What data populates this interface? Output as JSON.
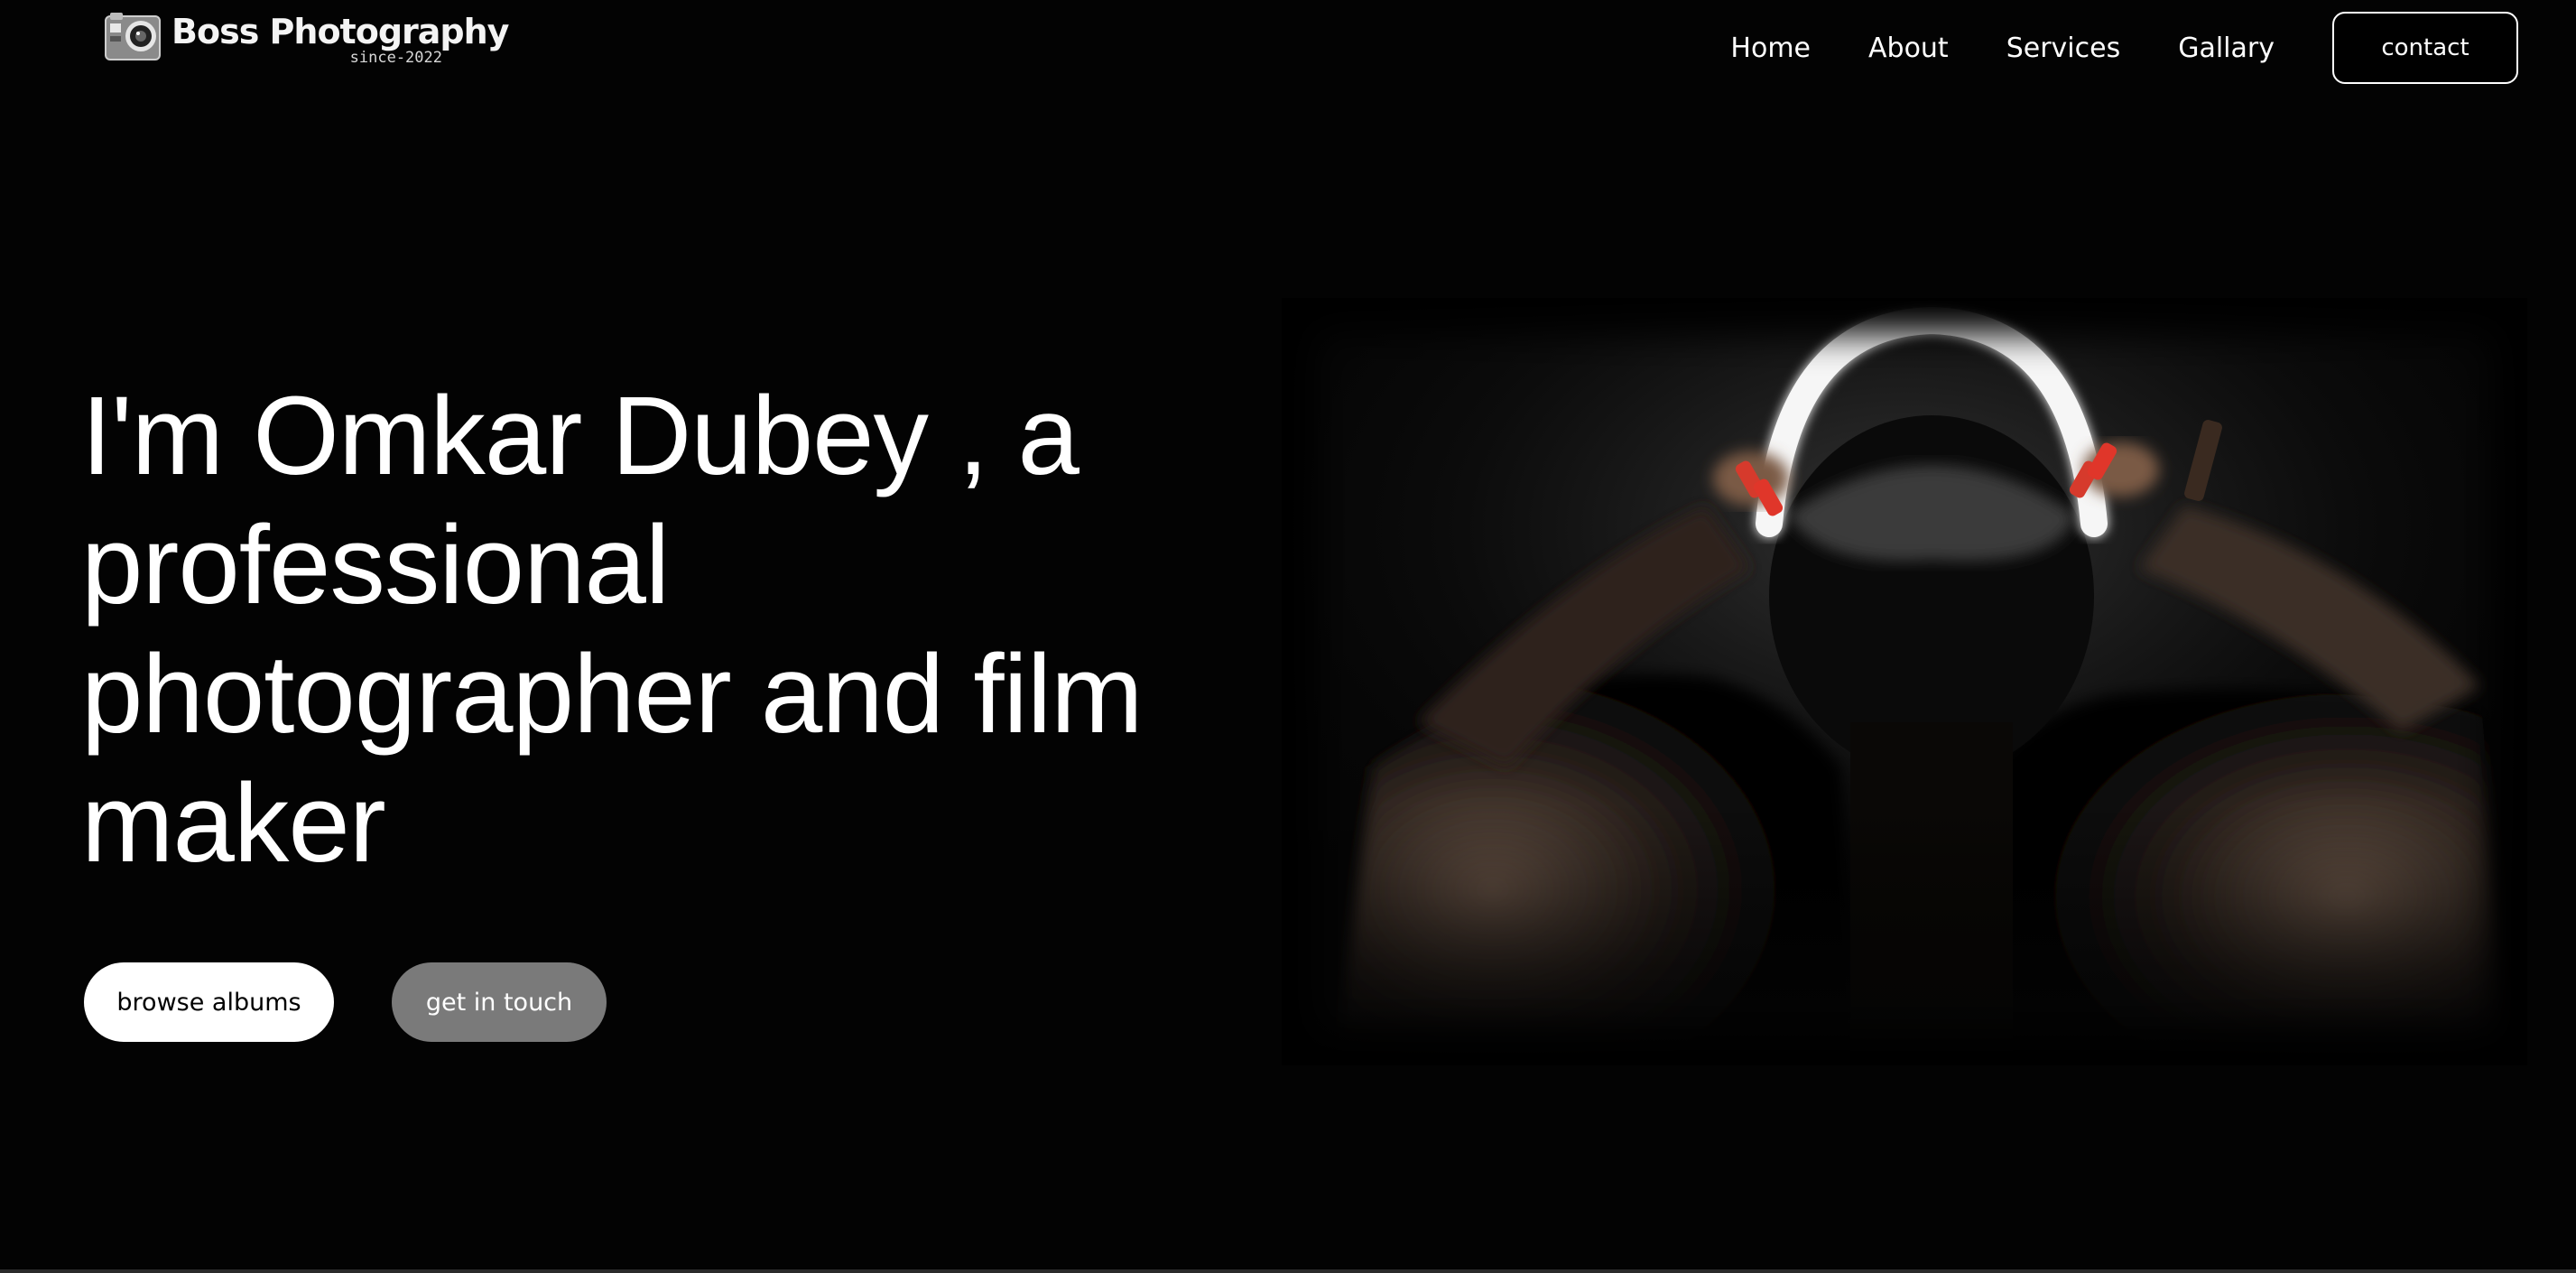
{
  "brand": {
    "name": "Boss Photography",
    "tagline": "since-2022"
  },
  "nav": {
    "links": [
      "Home",
      "About",
      "Services",
      "Gallary"
    ],
    "contact_label": "contact"
  },
  "hero": {
    "heading": "I'm Omkar Dubey , a professional photographer and film maker",
    "browse_label": "browse albums",
    "touch_label": "get in touch"
  },
  "colors": {
    "background": "#030303",
    "text": "#ffffff",
    "secondary_button": "#7a7a7a",
    "ring_light": "#f4f4f4",
    "accent_red": "#e0362a"
  },
  "icons": {
    "logo": "camera-icon"
  }
}
